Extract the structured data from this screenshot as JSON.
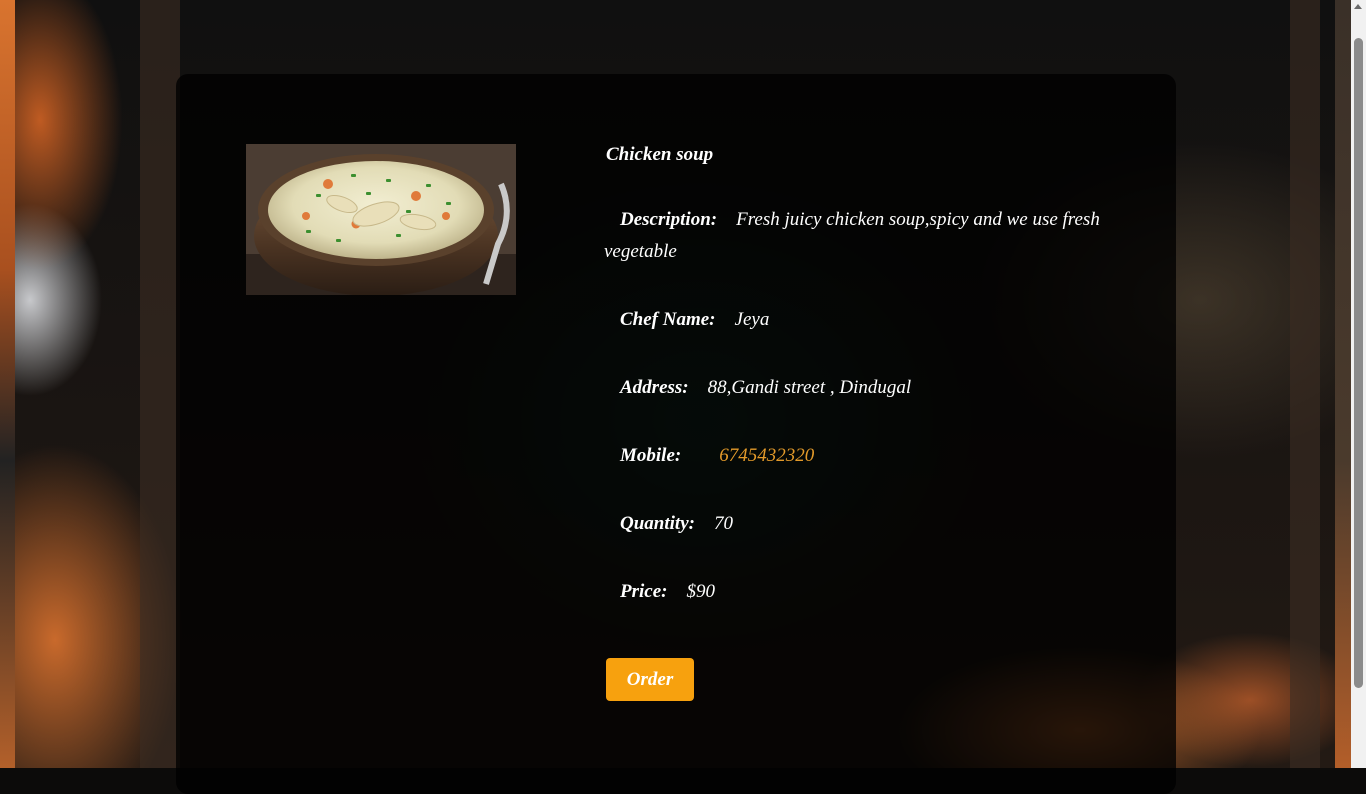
{
  "product": {
    "name": "Chicken soup",
    "description_label": "Description:",
    "description": "Fresh juicy chicken soup,spicy and we use fresh vegetable",
    "chef_label": "Chef Name:",
    "chef": "Jeya",
    "address_label": "Address:",
    "address": "88,Gandi street , Dindugal",
    "mobile_label": "Mobile:",
    "mobile": "6745432320",
    "quantity_label": "Quantity:",
    "quantity": "70",
    "price_label": "Price:",
    "price": "$90",
    "image": "chicken-soup-bowl-image"
  },
  "actions": {
    "order_label": "Order"
  },
  "colors": {
    "accent": "#f7a10e",
    "mobile_text": "#e39a2a",
    "card_bg": "rgba(0,0,0,0.78)",
    "text": "#ffffff"
  }
}
